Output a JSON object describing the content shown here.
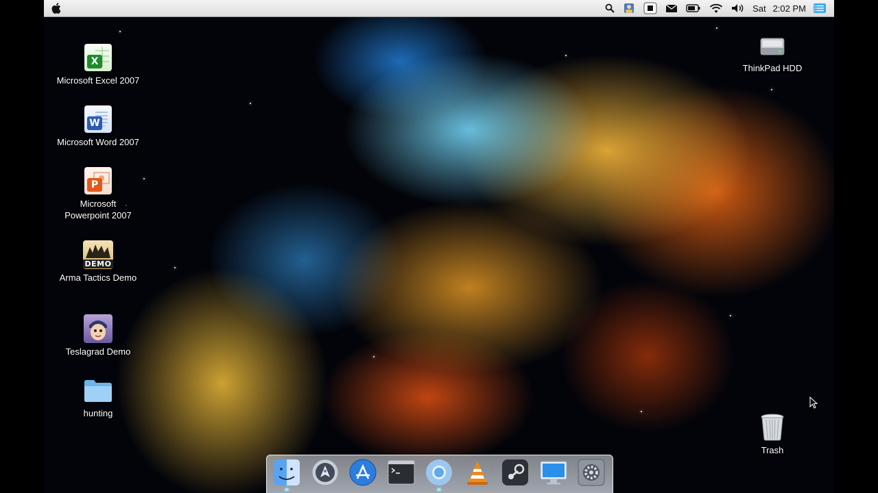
{
  "menubar": {
    "day": "Sat",
    "time": "2:02 PM",
    "icons": [
      "apple-logo",
      "spotlight-search-icon",
      "user-account-icon",
      "stop-recording-icon",
      "mail-icon",
      "battery-icon",
      "wifi-icon",
      "volume-icon",
      "notification-center-icon"
    ]
  },
  "desktop_icons": [
    {
      "name": "excel",
      "label": "Microsoft Excel 2007",
      "icon": "excel-icon"
    },
    {
      "name": "word",
      "label": "Microsoft Word 2007",
      "icon": "word-icon"
    },
    {
      "name": "powerpoint",
      "label_line1": "Microsoft",
      "label_line2": "Powerpoint 2007",
      "icon": "powerpoint-icon"
    },
    {
      "name": "arma",
      "label": "Arma Tactics Demo",
      "badge": "DEMO",
      "icon": "arma-icon"
    },
    {
      "name": "teslagrad",
      "label": "Teslagrad Demo",
      "icon": "teslagrad-icon"
    },
    {
      "name": "hunting",
      "label": "hunting",
      "icon": "folder-icon"
    },
    {
      "name": "hdd",
      "label": "ThinkPad HDD",
      "icon": "hard-drive-icon"
    },
    {
      "name": "trash",
      "label": "Trash",
      "icon": "trash-icon"
    }
  ],
  "dock": [
    "finder-icon",
    "launchpad-icon",
    "app-store-icon",
    "terminal-icon",
    "chrome-icon",
    "vlc-icon",
    "steam-icon",
    "remote-desktop-icon",
    "system-preferences-icon"
  ]
}
